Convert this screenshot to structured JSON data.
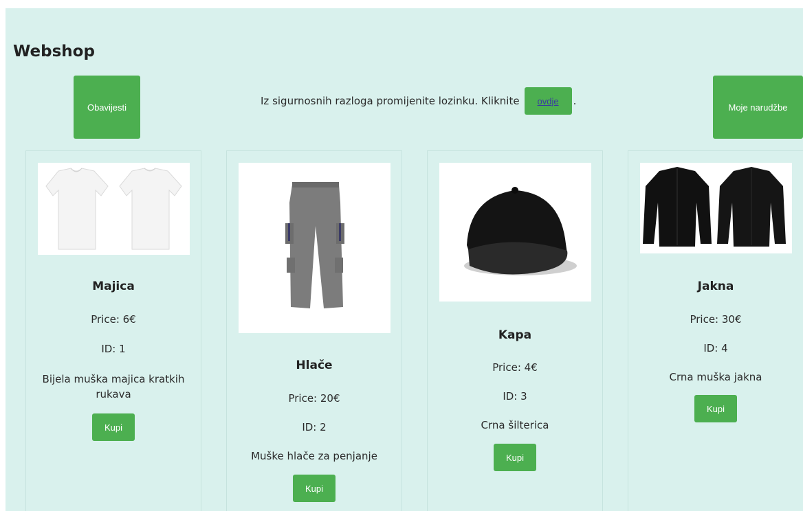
{
  "header": {
    "title": "Webshop",
    "notifications_label": "Obavijesti",
    "orders_label": "Moje narudžbe",
    "notice_text": "Iz sigurnosnih razloga promijenite lozinku. Kliknite",
    "notice_link": "ovdje",
    "notice_end": "."
  },
  "colors": {
    "page_bg": "#d9f1ed",
    "button": "#4caf50"
  },
  "products": [
    {
      "name": "Majica",
      "price": "Price: 6€",
      "id": "ID: 1",
      "description": "Bijela muška majica kratkih rukava",
      "buy": "Kupi",
      "image": "t-shirt"
    },
    {
      "name": "Hlače",
      "price": "Price: 20€",
      "id": "ID: 2",
      "description": "Muške hlače za penjanje",
      "buy": "Kupi",
      "image": "pants"
    },
    {
      "name": "Kapa",
      "price": "Price: 4€",
      "id": "ID: 3",
      "description": "Crna šilterica",
      "buy": "Kupi",
      "image": "cap"
    },
    {
      "name": "Jakna",
      "price": "Price: 30€",
      "id": "ID: 4",
      "description": "Crna muška jakna",
      "buy": "Kupi",
      "image": "jacket"
    }
  ]
}
